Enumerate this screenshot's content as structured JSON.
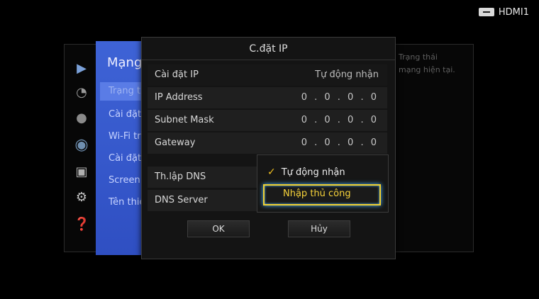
{
  "badge": {
    "input_label": "HDMI1"
  },
  "background_menu": {
    "category_title": "Mạng",
    "items": [
      "Trạng thái",
      "Cài đặt",
      "Wi-Fi trực tiếp",
      "Cài đặt",
      "Screen",
      "Tên thiết bị"
    ],
    "description_lines": [
      "Trạng thái",
      "mạng hiện tại."
    ]
  },
  "dialog": {
    "title": "C.đặt IP",
    "rows": [
      {
        "label": "Cài đặt IP",
        "value": "Tự động nhận"
      },
      {
        "label": "IP Address",
        "value": "0 . 0 . 0 . 0"
      },
      {
        "label": "Subnet Mask",
        "value": "0 . 0 . 0 . 0"
      },
      {
        "label": "Gateway",
        "value": "0 . 0 . 0 . 0"
      },
      {
        "label": "Th.lập DNS",
        "value": ""
      },
      {
        "label": "DNS Server",
        "value": ""
      }
    ],
    "dns_dropdown": {
      "options": [
        "Tự động nhận",
        "Nhập thủ công"
      ],
      "checked": "Tự động nhận",
      "focused": "Nhập thủ công"
    },
    "buttons": {
      "ok": "OK",
      "cancel": "Hủy"
    }
  },
  "colors": {
    "focus_yellow": "#f2d030",
    "focus_glow": "#4ab3ff",
    "menu_blue": "#3e63d6"
  },
  "icons": [
    "network-icon",
    "clock-icon",
    "speaker-icon",
    "globe-icon",
    "box-icon",
    "gear-icon",
    "help-icon"
  ]
}
